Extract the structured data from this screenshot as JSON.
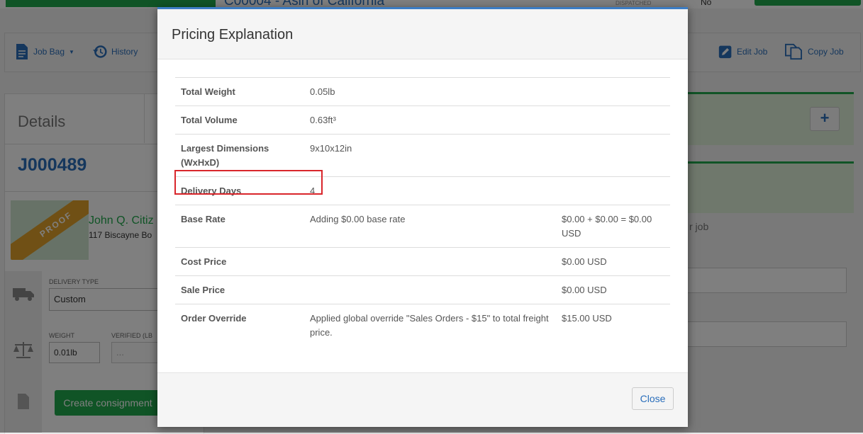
{
  "background": {
    "top_title": "C00004 - Asin of California",
    "top_status_label": "DISPATCHED",
    "top_status_value": "No",
    "toolbar": {
      "job_bag": "Job Bag",
      "history": "History",
      "edit_job": "Edit Job",
      "copy_job": "Copy Job"
    },
    "details_heading": "Details",
    "job_number": "J000489",
    "proof_label": "PROOF",
    "customer_name": "John Q. Citiz",
    "customer_address": "117 Biscayne Bo",
    "delivery_type_label": "DELIVERY TYPE",
    "delivery_type_value": "Custom",
    "weight_label": "WEIGHT",
    "weight_value": "0.01lb",
    "verified_label": "VERIFIED (LB",
    "verified_placeholder": "...",
    "create_consignment": "Create consignment",
    "right_text": "r job",
    "plus": "+"
  },
  "modal": {
    "title": "Pricing Explanation",
    "rows": [
      {
        "label": "Total Weight",
        "detail": "0.05lb",
        "amount": ""
      },
      {
        "label": "Total Volume",
        "detail": "0.63ft³",
        "amount": ""
      },
      {
        "label": "Largest Dimensions (WxHxD)",
        "detail": "9x10x12in",
        "amount": ""
      },
      {
        "label": "Delivery Days",
        "detail": "4",
        "amount": ""
      },
      {
        "label": "Base Rate",
        "detail": "Adding $0.00 base rate",
        "amount": "$0.00 + $0.00 = $0.00 USD"
      },
      {
        "label": "Cost Price",
        "detail": "",
        "amount": "$0.00 USD"
      },
      {
        "label": "Sale Price",
        "detail": "",
        "amount": "$0.00 USD"
      },
      {
        "label": "Order Override",
        "detail": "Applied global override \"Sales Orders - $15\" to total freight price.",
        "amount": "$15.00 USD"
      }
    ],
    "close_label": "Close"
  },
  "colors": {
    "accent_blue": "#2a6ebb",
    "brand_green": "#21a84d",
    "highlight_red": "#d9262b",
    "proof_orange": "#e0a12a"
  }
}
